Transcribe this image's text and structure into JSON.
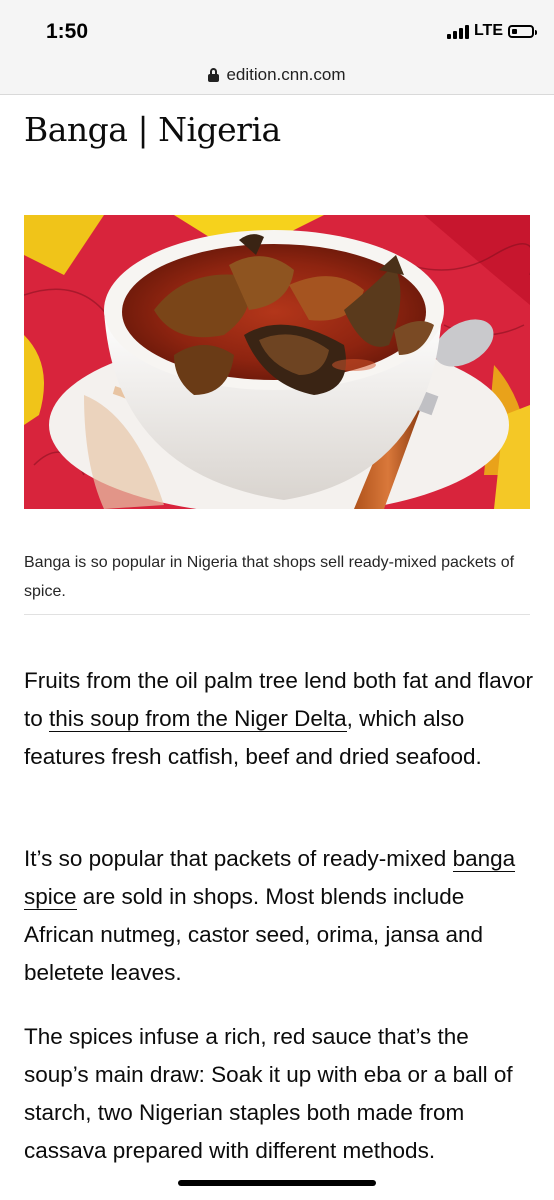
{
  "status_bar": {
    "time": "1:50",
    "network": "LTE",
    "signal_bars": 4,
    "battery_level": 0.25
  },
  "browser": {
    "url": "edition.cnn.com"
  },
  "article": {
    "headline": "Banga | Nigeria",
    "image_alt": "Bowl of banga soup with catfish",
    "caption": "Banga is so popular in Nigeria that shops sell ready-mixed packets of spice.",
    "paragraphs": [
      {
        "before": "Fruits from the oil palm tree lend both fat and flavor to ",
        "link": "this soup from the Niger Delta",
        "after": ", which also features fresh catfish, beef and dried seafood."
      },
      {
        "before": "It’s so popular that packets of ready-mixed ",
        "link": "banga spice",
        "after": " are sold in shops. Most blends include African nutmeg, castor seed, orima, jansa and beletete leaves."
      },
      {
        "text": "The spices infuse a rich, red sauce that’s the soup’s main draw: Soak it up with eba or a ball of starch, two Nigerian staples both made from cassava prepared with different methods."
      }
    ]
  },
  "colors": {
    "text": "#0c0c0c",
    "chrome": "#f5f5f5",
    "caption": "#262626",
    "divider": "#e1e1e1"
  }
}
